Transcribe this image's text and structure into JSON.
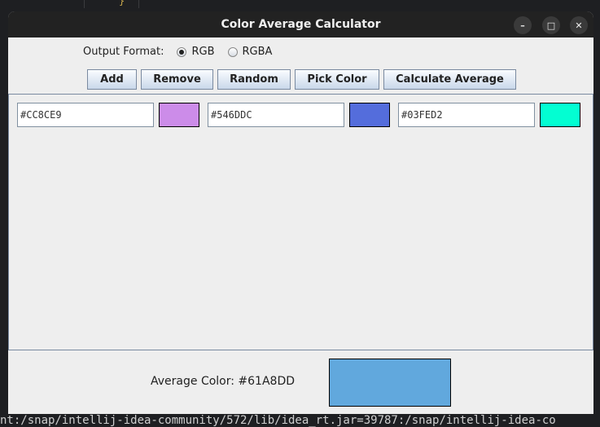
{
  "window": {
    "title": "Color Average Calculator"
  },
  "background": {
    "code_fragment": "}",
    "terminal_text": "nt:/snap/intellij-idea-community/572/lib/idea_rt.jar=39787:/snap/intellij-idea-co"
  },
  "format": {
    "label": "Output Format:",
    "options": [
      {
        "label": "RGB",
        "selected": true
      },
      {
        "label": "RGBA",
        "selected": false
      }
    ]
  },
  "toolbar": {
    "add": "Add",
    "remove": "Remove",
    "random": "Random",
    "pick": "Pick Color",
    "calculate": "Calculate Average"
  },
  "colors": [
    {
      "hex": "#CC8CE9",
      "swatch": "#cc8ce9"
    },
    {
      "hex": "#546DDC",
      "swatch": "#546ddc"
    },
    {
      "hex": "#03FED2",
      "swatch": "#03fed2"
    }
  ],
  "average": {
    "label": "Average Color: #61A8DD",
    "swatch": "#61a8dd"
  }
}
